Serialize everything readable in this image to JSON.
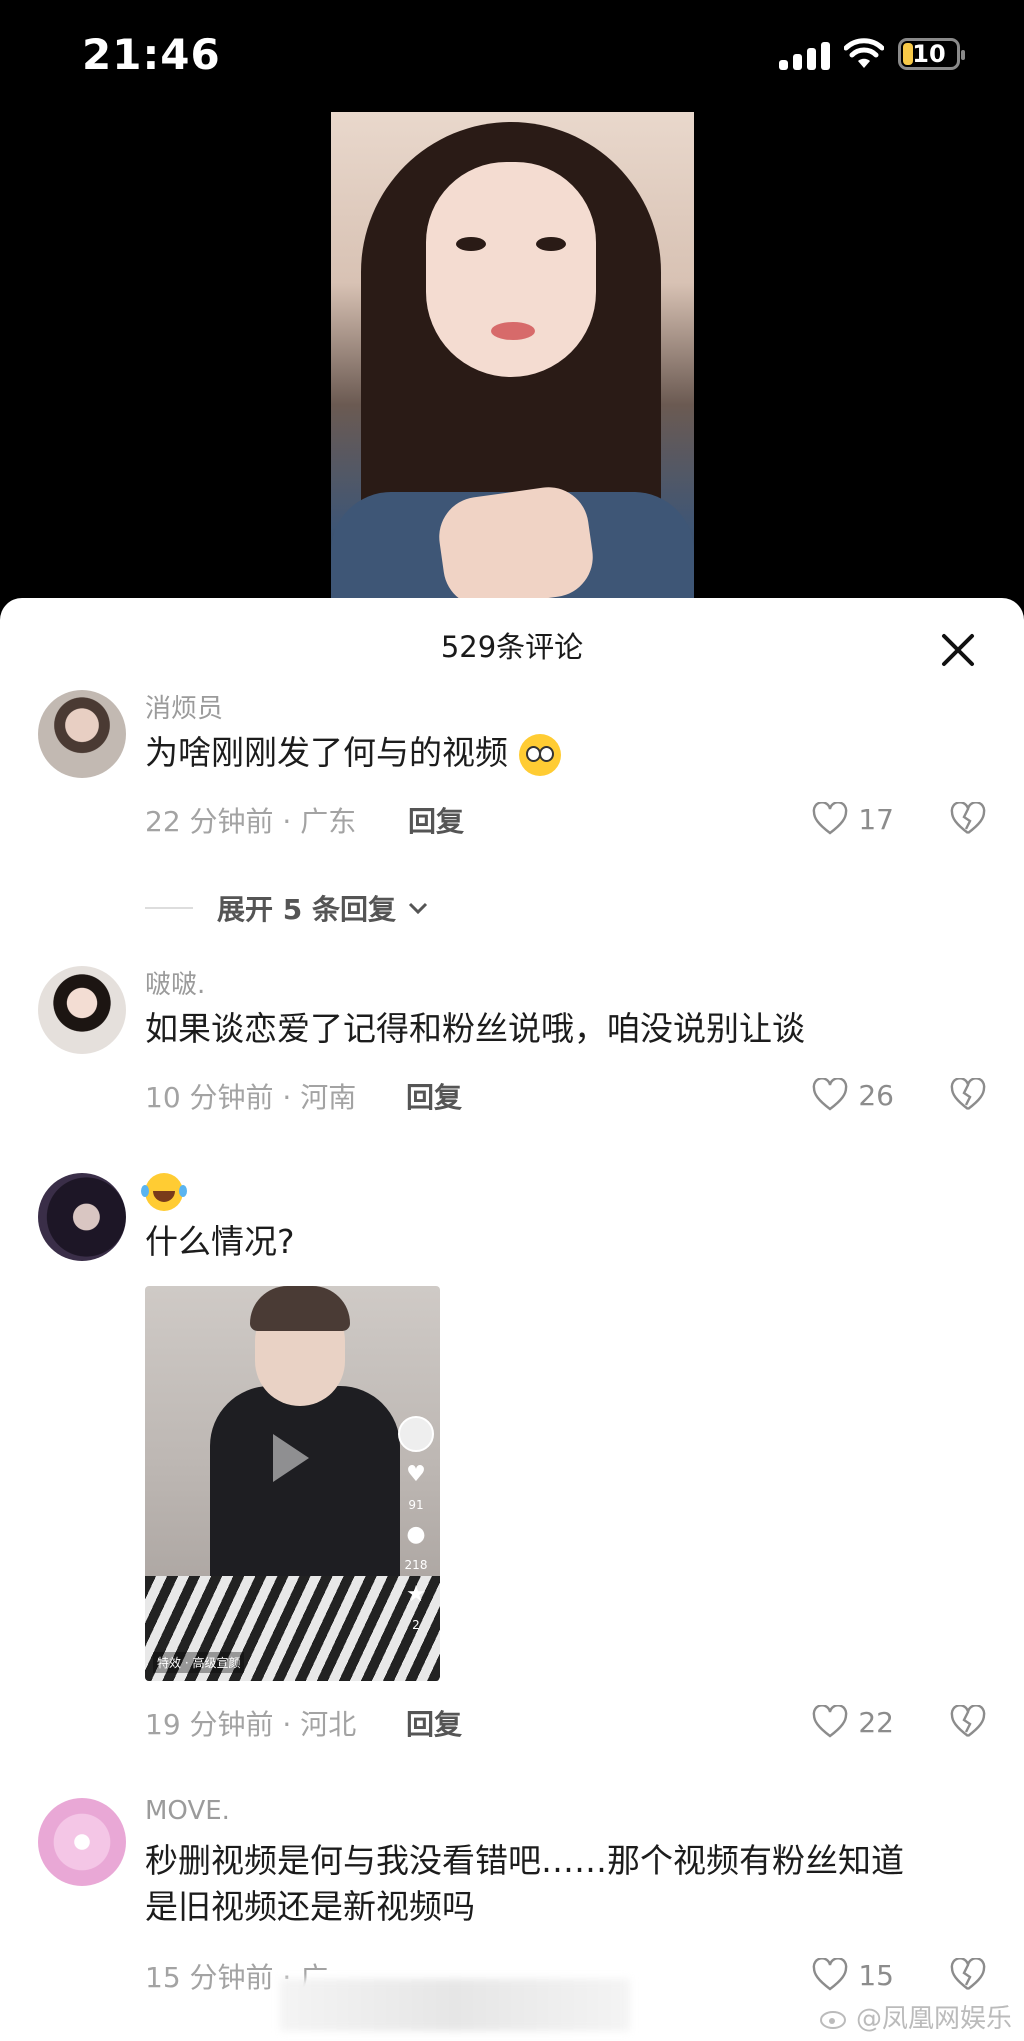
{
  "status_bar": {
    "time": "21:46",
    "battery": "10",
    "colors": {
      "battery_fill": "#f7c948"
    }
  },
  "video": {
    "description_icon": "video-frame"
  },
  "sheet": {
    "title": "529条评论",
    "close_icon": "close-icon"
  },
  "comments": [
    {
      "user": "消烦员",
      "text": "为啥刚刚发了何与的视频",
      "emoji": "flushed-face-emoji",
      "time_location": "22 分钟前 · 广东",
      "reply_label": "回复",
      "likes": "17"
    },
    {
      "user": "啵啵.",
      "text": "如果谈恋爱了记得和粉丝说哦，咱没说别让谈",
      "time_location": "10 分钟前 · 河南",
      "reply_label": "回复",
      "likes": "26"
    },
    {
      "user_emoji": "laughing-tears-emoji",
      "text": "什么情况?",
      "video_thumb": {
        "likes": "91",
        "comments": "218",
        "stars": "2",
        "tag": "特效 · 高级宣颜"
      },
      "time_location": "19 分钟前 · 河北",
      "reply_label": "回复",
      "likes": "22"
    },
    {
      "user": "MOVE.",
      "text_line1": "秒删视频是何与我没看错吧……那个视频有粉丝知道",
      "text_line2": "是旧视频还是新视频吗",
      "time_location": "15 分钟前 · 广",
      "likes": "15"
    }
  ],
  "expand_replies": "展开 5 条回复",
  "watermark": "@凤凰网娱乐"
}
